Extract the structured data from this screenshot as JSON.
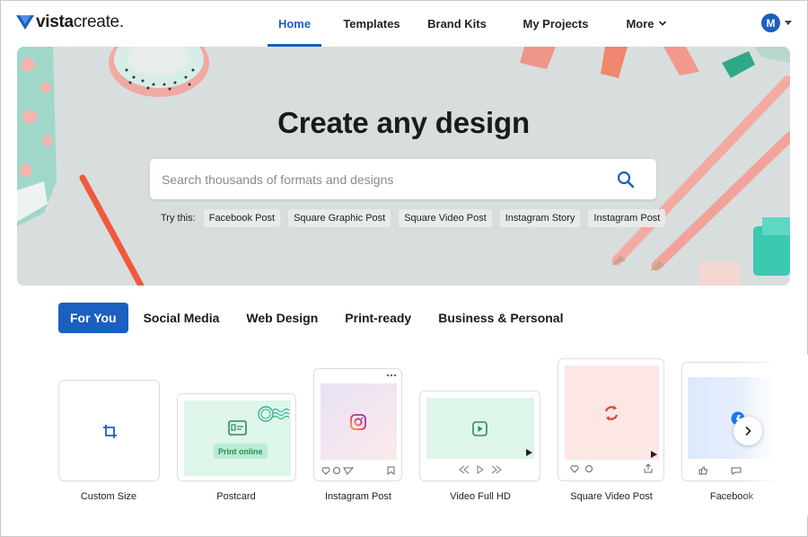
{
  "header": {
    "logo_bold": "vista",
    "logo_light": "create.",
    "nav": [
      {
        "label": "Home",
        "active": true
      },
      {
        "label": "Templates"
      },
      {
        "label": "Brand Kits"
      },
      {
        "label": "My Projects"
      },
      {
        "label": "More"
      }
    ],
    "avatar_initial": "M"
  },
  "hero": {
    "title": "Create any design",
    "search_placeholder": "Search thousands of formats and designs",
    "try_label": "Try this:",
    "suggestions": [
      "Facebook Post",
      "Square Graphic Post",
      "Square Video Post",
      "Instagram Story",
      "Instagram Post"
    ]
  },
  "categories": [
    "For You",
    "Social Media",
    "Web Design",
    "Print-ready",
    "Business & Personal"
  ],
  "cards": [
    {
      "label": "Custom Size",
      "icon": "crop-icon"
    },
    {
      "label": "Postcard",
      "icon": "postcard-icon",
      "badge": "Print online"
    },
    {
      "label": "Instagram Post",
      "icon": "instagram-icon"
    },
    {
      "label": "Video Full HD",
      "icon": "play-icon"
    },
    {
      "label": "Square Video Post",
      "icon": "refresh-icon"
    },
    {
      "label": "Facebook",
      "icon": "facebook-icon"
    }
  ],
  "colors": {
    "accent": "#1b5fc1",
    "mint": "#def5ea",
    "green_icon": "#2f8a5a",
    "pink_card": "#fde7e4",
    "red_icon": "#e0443a"
  }
}
